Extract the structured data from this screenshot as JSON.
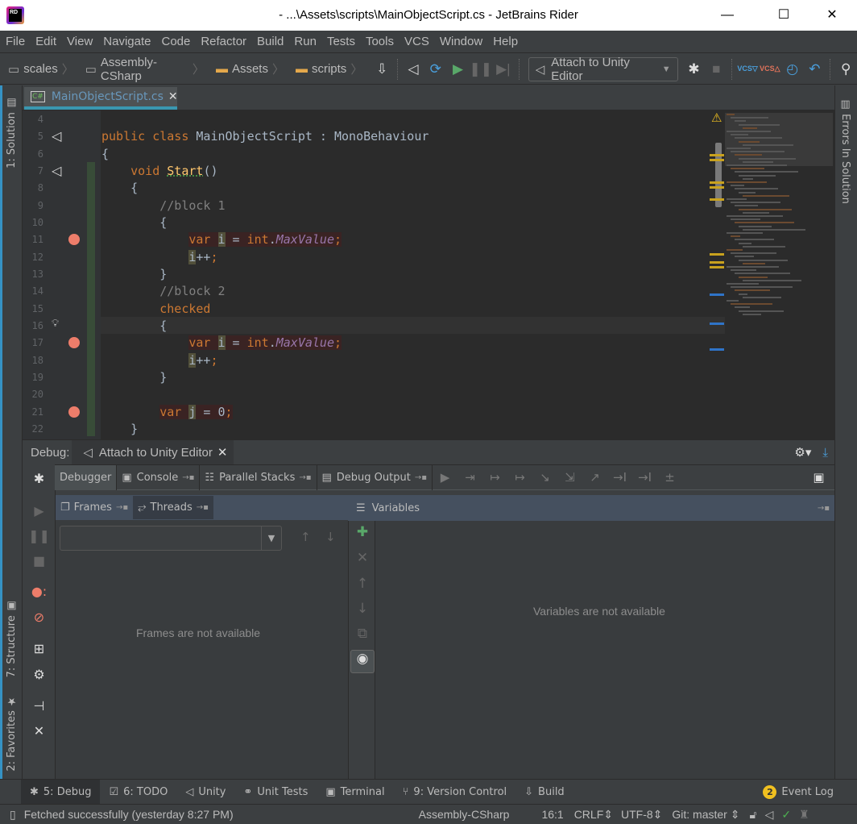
{
  "window": {
    "title": "- ...\\Assets\\scripts\\MainObjectScript.cs - JetBrains Rider",
    "logo_text": "RD",
    "controls": {
      "minimize": "—",
      "maximize": "☐",
      "close": "✕"
    }
  },
  "menu": [
    "File",
    "Edit",
    "View",
    "Navigate",
    "Code",
    "Refactor",
    "Build",
    "Run",
    "Tests",
    "Tools",
    "VCS",
    "Window",
    "Help"
  ],
  "breadcrumbs": [
    {
      "label": "scales",
      "icon": "solution-icon"
    },
    {
      "label": "Assembly-CSharp",
      "icon": "csharp-project-icon"
    },
    {
      "label": "Assets",
      "icon": "folder-icon"
    },
    {
      "label": "scripts",
      "icon": "folder-icon"
    }
  ],
  "run_config": {
    "label": "Attach to Unity Editor"
  },
  "left_strip": {
    "solution": "1: Solution",
    "structure": "7: Structure",
    "favorites": "2: Favorites"
  },
  "right_strip": {
    "errors": "Errors In Solution"
  },
  "editor": {
    "tab": {
      "label": "MainObjectScript.cs",
      "icon_text": "C#"
    },
    "lines": [
      {
        "n": "4",
        "tokens": []
      },
      {
        "n": "5",
        "gutter": "unity",
        "tokens": [
          [
            "kw",
            "public "
          ],
          [
            "kw",
            "class "
          ],
          [
            "id",
            "MainObjectScript : MonoBehaviour"
          ]
        ]
      },
      {
        "n": "6",
        "tokens": [
          [
            "id",
            "{"
          ]
        ]
      },
      {
        "n": "7",
        "gutter": "unity",
        "tokens": [
          [
            "id",
            "    "
          ],
          [
            "kw",
            "void "
          ],
          [
            "mt",
            "Start"
          ],
          [
            "id",
            "()"
          ]
        ]
      },
      {
        "n": "8",
        "tokens": [
          [
            "id",
            "    {"
          ]
        ]
      },
      {
        "n": "9",
        "tokens": [
          [
            "cm",
            "        //block 1"
          ]
        ]
      },
      {
        "n": "10",
        "tokens": [
          [
            "id",
            "        {"
          ]
        ]
      },
      {
        "n": "11",
        "gutter": "breakpoint",
        "tokens": [
          [
            "id",
            "            "
          ],
          [
            "kw",
            "var "
          ],
          [
            "hl",
            "i"
          ],
          [
            "id",
            " = "
          ],
          [
            "kw",
            "int"
          ],
          [
            "id",
            "."
          ],
          [
            "pr",
            "MaxValue"
          ],
          [
            "pn",
            ";"
          ]
        ]
      },
      {
        "n": "12",
        "tokens": [
          [
            "id",
            "            "
          ],
          [
            "hl",
            "i"
          ],
          [
            "id",
            "++"
          ],
          [
            "pn",
            ";"
          ]
        ]
      },
      {
        "n": "13",
        "tokens": [
          [
            "id",
            "        }"
          ]
        ]
      },
      {
        "n": "14",
        "tokens": [
          [
            "cm",
            "        //block 2"
          ]
        ]
      },
      {
        "n": "15",
        "tokens": [
          [
            "id",
            "        "
          ],
          [
            "kw",
            "checked"
          ]
        ]
      },
      {
        "n": "16",
        "gutter": "bulb",
        "tokens": [
          [
            "id",
            "        {"
          ]
        ]
      },
      {
        "n": "17",
        "gutter": "breakpoint",
        "tokens": [
          [
            "id",
            "            "
          ],
          [
            "kw",
            "var "
          ],
          [
            "hl",
            "i"
          ],
          [
            "id",
            " = "
          ],
          [
            "kw",
            "int"
          ],
          [
            "id",
            "."
          ],
          [
            "pr",
            "MaxValue"
          ],
          [
            "pn",
            ";"
          ]
        ]
      },
      {
        "n": "18",
        "tokens": [
          [
            "id",
            "            "
          ],
          [
            "hl",
            "i"
          ],
          [
            "id",
            "++"
          ],
          [
            "pn",
            ";"
          ]
        ]
      },
      {
        "n": "19",
        "tokens": [
          [
            "id",
            "        }"
          ]
        ]
      },
      {
        "n": "20",
        "tokens": []
      },
      {
        "n": "21",
        "gutter": "breakpoint",
        "tokens": [
          [
            "id",
            "        "
          ],
          [
            "kw",
            "var "
          ],
          [
            "hl",
            "j"
          ],
          [
            "id",
            " = "
          ],
          [
            "id",
            "0"
          ],
          [
            "pn",
            ";"
          ]
        ]
      },
      {
        "n": "22",
        "tokens": [
          [
            "id",
            "    }"
          ]
        ]
      }
    ]
  },
  "debug": {
    "label": "Debug:",
    "session_tab": "Attach to Unity Editor",
    "tabs": [
      {
        "label": "Debugger",
        "selected": true
      },
      {
        "label": "Console",
        "icon": "console-icon"
      },
      {
        "label": "Parallel Stacks",
        "icon": "parallel-stacks-icon"
      },
      {
        "label": "Debug Output",
        "icon": "debug-output-icon"
      }
    ],
    "frames_tab": "Frames",
    "threads_tab": "Threads",
    "variables_tab": "Variables",
    "frames_empty": "Frames are not available",
    "variables_empty": "Variables are not available"
  },
  "bottom_tools": [
    {
      "label": "5: Debug",
      "icon": "bug-icon",
      "selected": true
    },
    {
      "label": "6: TODO",
      "icon": "todo-icon"
    },
    {
      "label": "Unity",
      "icon": "unity-icon"
    },
    {
      "label": "Unit Tests",
      "icon": "unit-tests-icon"
    },
    {
      "label": "Terminal",
      "icon": "terminal-icon"
    },
    {
      "label": "9: Version Control",
      "icon": "vcs-icon"
    },
    {
      "label": "Build",
      "icon": "build-icon"
    }
  ],
  "event_log": {
    "label": "Event Log",
    "count": "2"
  },
  "status": {
    "message": "Fetched successfully (yesterday 8:27 PM)",
    "project": "Assembly-CSharp",
    "position": "16:1",
    "line_sep": "CRLF",
    "encoding": "UTF-8",
    "git": "Git: master"
  },
  "colors": {
    "keyword": "#cc7832",
    "comment": "#808080",
    "property": "#9876aa",
    "breakpoint": "#ed7d6a",
    "accent": "#3592c4"
  }
}
